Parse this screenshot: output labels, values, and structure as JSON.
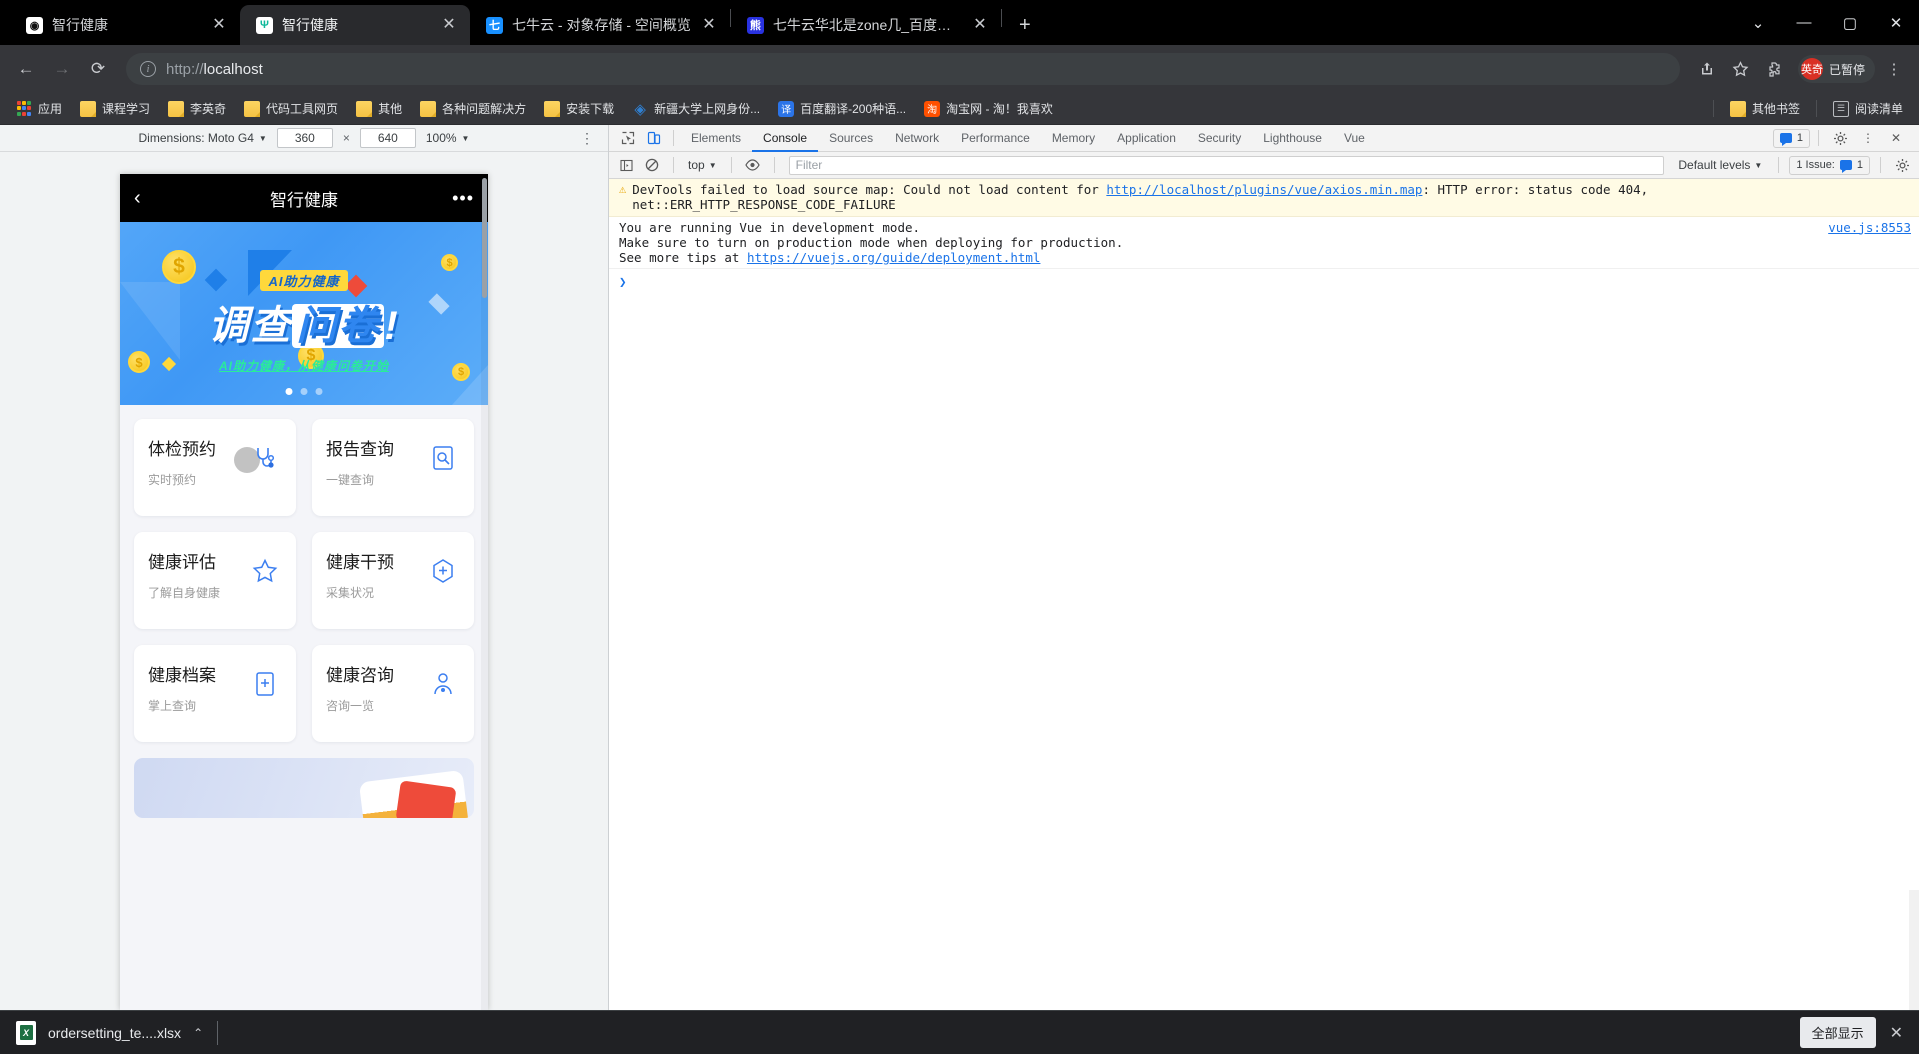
{
  "browser": {
    "tabs": [
      {
        "title": "智行健康",
        "favicon": "health-app-icon",
        "active": false
      },
      {
        "title": "智行健康",
        "favicon": "health-app-icon",
        "active": true
      },
      {
        "title": "七牛云 - 对象存储 - 空间概览",
        "favicon": "qiniu-cloud-icon",
        "active": false
      },
      {
        "title": "七牛云华北是zone几_百度搜索",
        "favicon": "baidu-icon",
        "active": false
      }
    ],
    "new_tab_label": "+",
    "window_controls": {
      "minimize": "—",
      "maximize": "▢",
      "close": "✕",
      "list": "⌄"
    },
    "nav": {
      "back": "←",
      "forward": "→",
      "reload": "⟳"
    },
    "address": {
      "scheme": "http://",
      "host": "localhost",
      "full": "http://localhost",
      "info_icon": "i"
    },
    "toolbar_icons": [
      "share-icon",
      "bookmark-star-icon",
      "extension-puzzle-icon"
    ],
    "profile": {
      "avatar_label": "英奇",
      "status": "已暂停"
    }
  },
  "bookmarks": {
    "items": [
      {
        "label": "应用",
        "icon": "apps-grid-icon"
      },
      {
        "label": "课程学习",
        "icon": "folder-icon"
      },
      {
        "label": "李英奇",
        "icon": "folder-icon"
      },
      {
        "label": "代码工具网页",
        "icon": "folder-icon"
      },
      {
        "label": "其他",
        "icon": "folder-icon"
      },
      {
        "label": "各种问题解决方",
        "icon": "folder-icon"
      },
      {
        "label": "安装下载",
        "icon": "folder-icon"
      },
      {
        "label": "新疆大学上网身份...",
        "icon": "xinjiang-university-icon"
      },
      {
        "label": "百度翻译-200种语...",
        "icon": "baidu-translate-icon"
      },
      {
        "label": "淘宝网 - 淘！我喜欢",
        "icon": "taobao-icon"
      }
    ],
    "right_items": [
      {
        "label": "其他书签",
        "icon": "folder-icon"
      },
      {
        "label": "阅读清单",
        "icon": "reading-list-icon"
      }
    ]
  },
  "device_toolbar": {
    "dimensions_label": "Dimensions: Moto G4",
    "width": "360",
    "height": "640",
    "multiply": "×",
    "zoom": "100%",
    "more_icon": "kebab-menu-icon"
  },
  "mobile_app": {
    "header": {
      "back_icon": "chevron-left-icon",
      "title": "智行健康",
      "menu_icon": "ellipsis-icon"
    },
    "banner": {
      "tag": "AI助力健康",
      "title_left": "调查",
      "title_right": "问卷",
      "exclaim": "!",
      "subtitle": "AI助力健康，从健康问卷开始",
      "dots": 3,
      "active_dot": 0
    },
    "cards": [
      {
        "title": "体检预约",
        "subtitle": "实时预约",
        "icon": "stethoscope-icon"
      },
      {
        "title": "报告查询",
        "subtitle": "一键查询",
        "icon": "document-search-icon"
      },
      {
        "title": "健康评估",
        "subtitle": "了解自身健康",
        "icon": "star-icon"
      },
      {
        "title": "健康干预",
        "subtitle": "采集状况",
        "icon": "target-plus-icon"
      },
      {
        "title": "健康档案",
        "subtitle": "掌上查询",
        "icon": "file-medical-icon"
      },
      {
        "title": "健康咨询",
        "subtitle": "咨询一览",
        "icon": "person-support-icon"
      }
    ]
  },
  "devtools": {
    "inspect_icon": "inspect-element-icon",
    "device_toggle_icon": "device-toolbar-icon",
    "tabs": [
      "Elements",
      "Console",
      "Sources",
      "Network",
      "Performance",
      "Memory",
      "Application",
      "Security",
      "Lighthouse",
      "Vue"
    ],
    "selected_tab": "Console",
    "messages_chip": "1",
    "settings_icon": "gear-icon",
    "more_icon": "kebab-menu-icon",
    "close_icon": "close-icon",
    "filterbar": {
      "sidebar_icon": "console-sidebar-icon",
      "clear_icon": "clear-console-icon",
      "context": "top",
      "eye_icon": "live-expression-icon",
      "filter_placeholder": "Filter",
      "levels": "Default levels",
      "issues_label": "1 Issue:",
      "issues_count": "1",
      "settings_icon": "gear-icon"
    },
    "console_messages": [
      {
        "type": "warning",
        "icon": "warning-triangle-icon",
        "text_before": "DevTools failed to load source map: Could not load content for ",
        "link": "http://localhost/plugins/vue/axios.min.map",
        "text_after": ": HTTP error: status code 404, net::ERR_HTTP_RESPONSE_CODE_FAILURE",
        "source": ""
      },
      {
        "type": "info",
        "line1": "You are running Vue in development mode.",
        "line2": "Make sure to turn on production mode when deploying for production.",
        "line3_before": "See more tips at ",
        "line3_link": "https://vuejs.org/guide/deployment.html",
        "source": "vue.js:8553"
      }
    ],
    "prompt": "❯"
  },
  "downloads": {
    "file_name": "ordersetting_te....xlsx",
    "file_icon": "xlsx-file-icon",
    "expand_icon": "chevron-up-icon",
    "show_all_label": "全部显示",
    "close_icon": "close-icon"
  }
}
